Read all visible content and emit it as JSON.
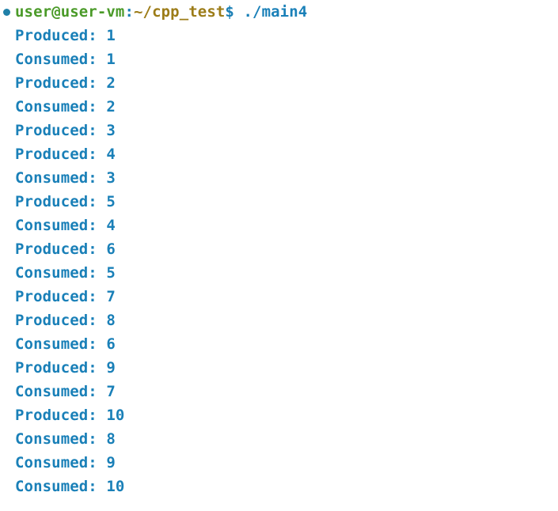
{
  "terminal": {
    "prompt": {
      "bullet_icon": "bullet-marker",
      "user_host": "user@user-vm",
      "separator": ":",
      "path": "~/cpp_test",
      "sigil": "$",
      "command": "./main4"
    },
    "output_lines": [
      "Produced: 1",
      "Consumed: 1",
      "Produced: 2",
      "Consumed: 2",
      "Produced: 3",
      "Produced: 4",
      "Consumed: 3",
      "Produced: 5",
      "Consumed: 4",
      "Produced: 6",
      "Consumed: 5",
      "Produced: 7",
      "Produced: 8",
      "Consumed: 6",
      "Produced: 9",
      "Consumed: 7",
      "Produced: 10",
      "Consumed: 8",
      "Consumed: 9",
      "Consumed: 10"
    ],
    "colors": {
      "background": "#ffffff",
      "bullet": "#2080a8",
      "user_host": "#4a9a28",
      "punctuation": "#1a7fb5",
      "path": "#9c7c18",
      "sigil": "#1a7fb5",
      "command": "#1a80b8",
      "output": "#1a80b8"
    }
  }
}
